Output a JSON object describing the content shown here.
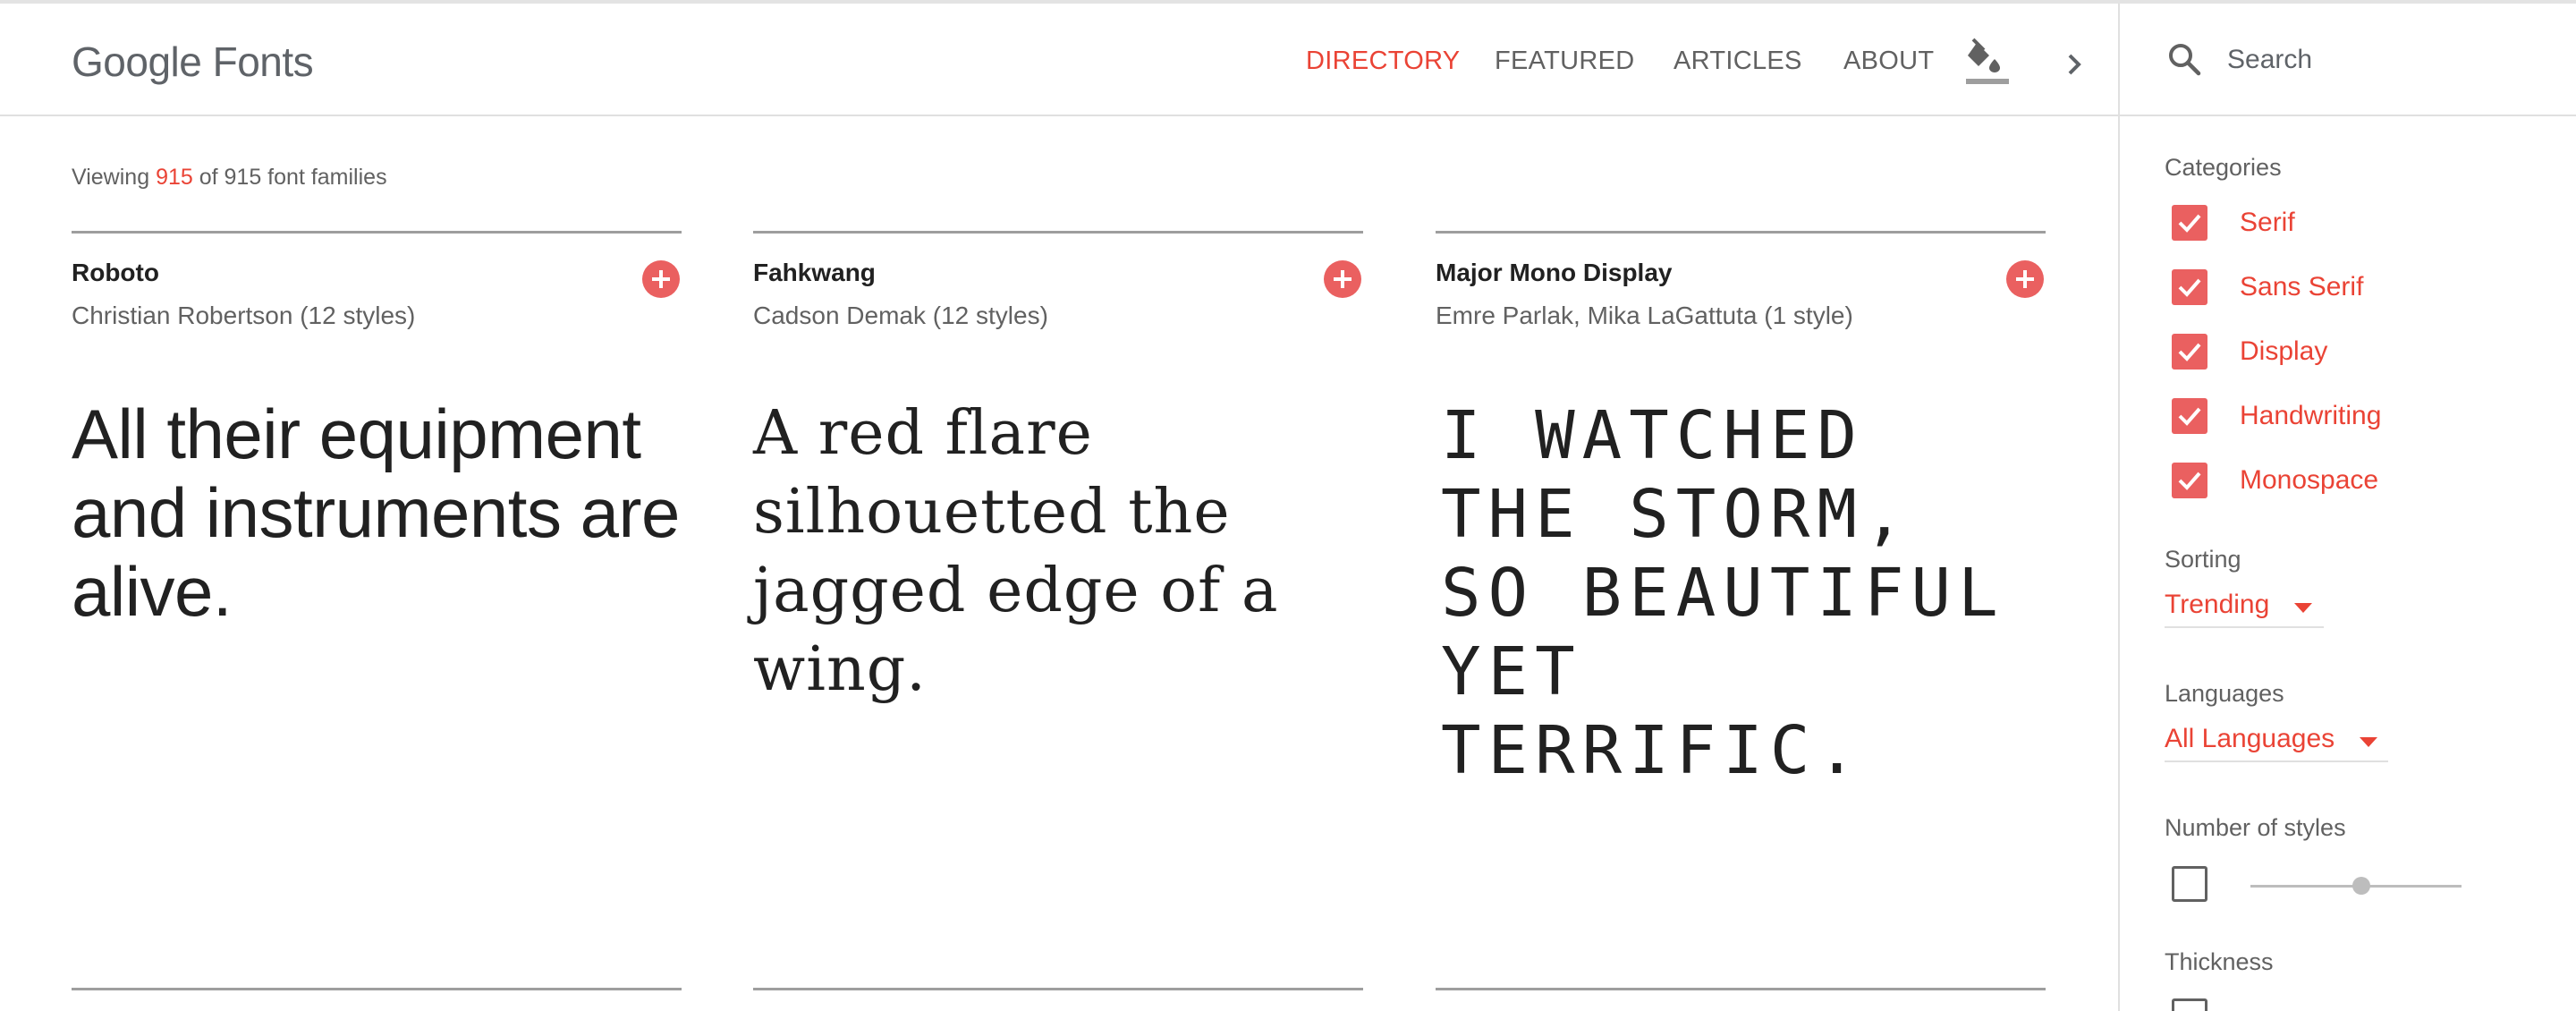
{
  "header": {
    "logo_brand": "Google",
    "logo_product": "Fonts",
    "nav": {
      "directory": "DIRECTORY",
      "featured": "FEATURED",
      "articles": "ARTICLES",
      "about": "ABOUT"
    },
    "theme_icon": "paint-bucket-icon",
    "more_icon": "chevron-right-icon"
  },
  "search": {
    "placeholder": "Search",
    "value": ""
  },
  "viewing": {
    "prefix": "Viewing",
    "shown": "915",
    "middle": "of 915 font families"
  },
  "cards": [
    {
      "name": "Roboto",
      "author": "Christian Robertson (12 styles)",
      "sample": "All their equipment and instruments are alive."
    },
    {
      "name": "Fahkwang",
      "author": "Cadson Demak (12 styles)",
      "sample": "A red flare silhouetted the jagged edge of a wing."
    },
    {
      "name": "Major Mono Display",
      "author": "Emre Parlak, Mika LaGattuta (1 style)",
      "sample": "I watched the storm, so beautiful yet terrific."
    }
  ],
  "filters": {
    "categories_label": "Categories",
    "categories": [
      {
        "label": "Serif",
        "checked": true
      },
      {
        "label": "Sans Serif",
        "checked": true
      },
      {
        "label": "Display",
        "checked": true
      },
      {
        "label": "Handwriting",
        "checked": true
      },
      {
        "label": "Monospace",
        "checked": true
      }
    ],
    "sorting_label": "Sorting",
    "sorting_value": "Trending",
    "languages_label": "Languages",
    "languages_value": "All Languages",
    "styles_label": "Number of styles",
    "styles_enabled": false,
    "thickness_label": "Thickness"
  },
  "colors": {
    "accent": "#ea4335",
    "checkbox": "#ea6060",
    "text": "#212121",
    "muted": "#616161"
  }
}
